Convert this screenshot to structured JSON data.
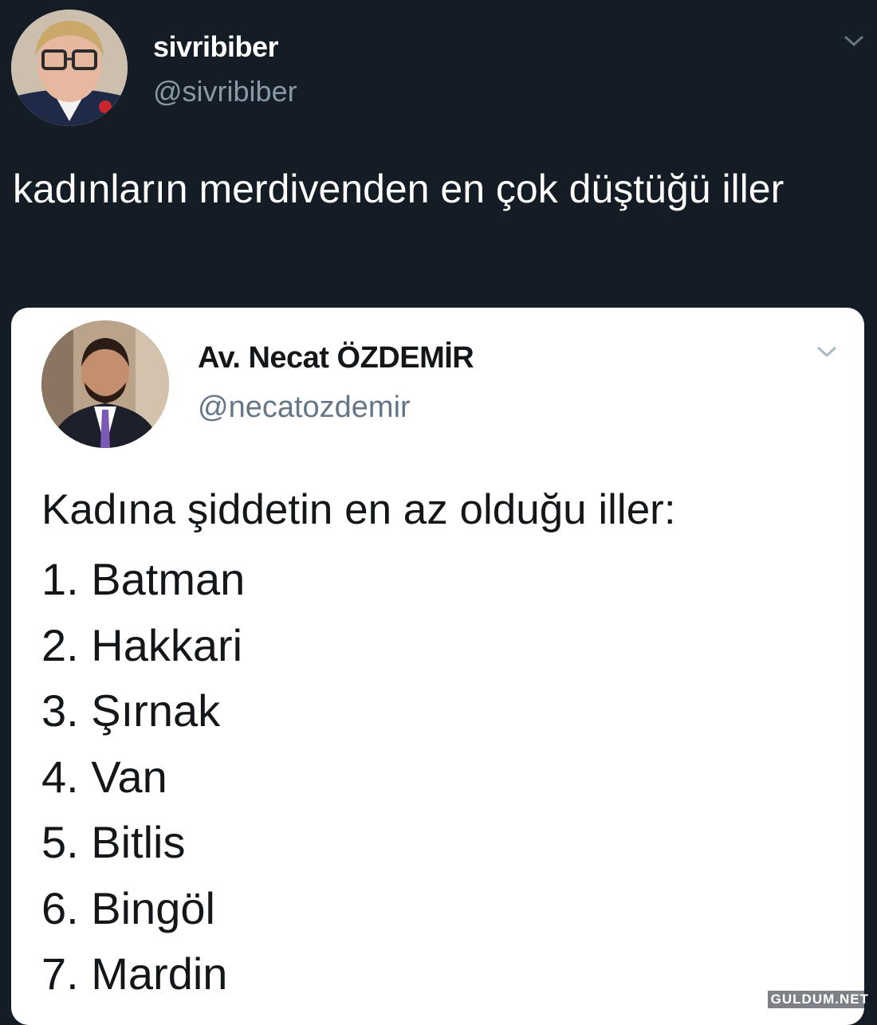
{
  "colors": {
    "background": "#141c26",
    "card_background": "#ffffff",
    "name_color": "#ffffff",
    "handle_color": "#8899a6",
    "quoted_text_color": "#14171a",
    "quoted_handle_color": "#657786"
  },
  "outer_tweet": {
    "author": {
      "name": "sivribiber",
      "handle": "@sivribiber",
      "avatar_icon": "profile-photo"
    },
    "menu_icon": "chevron-down-icon",
    "text": "kadınların merdivenden en çok düştüğü iller"
  },
  "quoted_tweet": {
    "author": {
      "name": "Av. Necat ÖZDEMİR",
      "handle": "@necatozdemir",
      "avatar_icon": "profile-photo"
    },
    "menu_icon": "chevron-down-icon",
    "heading": "Kadına şiddetin en az olduğu iller:",
    "items": [
      "1. Batman",
      "2. Hakkari",
      "3. Şırnak",
      "4. Van",
      "5. Bitlis",
      "6. Bingöl",
      "7. Mardin"
    ]
  },
  "watermark": "GULDUM.NET"
}
